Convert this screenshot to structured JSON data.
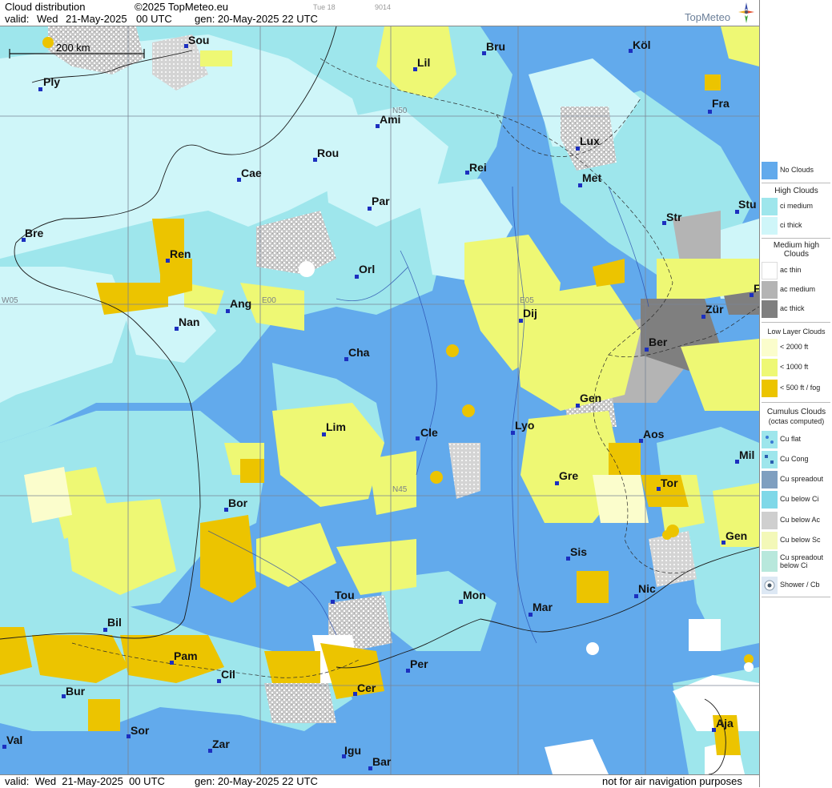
{
  "header": {
    "title": "Cloud distribution",
    "copyright": "©2025 TopMeteo.eu",
    "valid_label": "valid:",
    "valid_day": "Wed",
    "valid_date": "21-May-2025",
    "valid_time": "00 UTC",
    "generated": "gen: 20-May-2025 22 UTC",
    "small_1": "Tue 18",
    "small_2": "9014",
    "brand": "TopMeteo"
  },
  "footer": {
    "valid_text": "valid:  Wed  21-May-2025  00 UTC",
    "generated_text": "gen: 20-May-2025 22 UTC",
    "disclaimer": "not for air navigation purposes"
  },
  "map": {
    "scale_label": "200 km",
    "grid_labels": [
      "N50",
      "N45",
      "W05",
      "E00",
      "E05"
    ],
    "cities": [
      "Ply",
      "Sou",
      "Lil",
      "Bru",
      "Köl",
      "Ami",
      "Fra",
      "Lux",
      "Rou",
      "Cae",
      "Rei",
      "Met",
      "Par",
      "Bre",
      "Stu",
      "Str",
      "Ren",
      "Orl",
      "Ang",
      "Dij",
      "Zür",
      "Nan",
      "Cha",
      "Ber",
      "Gen",
      "Lim",
      "Cle",
      "Lyo",
      "Aos",
      "Mil",
      "Gre",
      "Tor",
      "Bor",
      "Gen",
      "Sis",
      "Tou",
      "Mon",
      "Nic",
      "Mar",
      "Bil",
      "Pam",
      "Per",
      "Cil",
      "Cer",
      "Bur",
      "Sor",
      "Val",
      "Zar",
      "Igu",
      "Aja",
      "Bar",
      "F"
    ]
  },
  "legend": {
    "no_clouds": "No Clouds",
    "high_title": "High Clouds",
    "high_items": [
      "ci medium",
      "ci thick"
    ],
    "medium_title": "Medium high Clouds",
    "medium_items": [
      "ac thin",
      "ac medium",
      "ac thick"
    ],
    "low_title": "Low Layer Clouds",
    "low_items": [
      "< 2000 ft",
      "< 1000 ft",
      "< 500 ft / fog"
    ],
    "cumulus_title": "Cumulus Clouds",
    "cumulus_subtitle": "(octas computed)",
    "cumulus_items": [
      "Cu flat",
      "Cu Cong",
      "Cu spreadout",
      "Cu below Ci",
      "Cu below Ac",
      "Cu below Sc",
      "Cu spreadout below Ci",
      "Shower / Cb"
    ]
  },
  "colors": {
    "no_clouds": "#62aaec",
    "ci_medium": "#9ee6ec",
    "ci_thick": "#cff6f9",
    "ac_thin": "#ffffff",
    "ac_medium": "#b4b4b4",
    "ac_thick": "#7f7f7f",
    "low_2000": "#fbfdcc",
    "low_1000": "#eef874",
    "low_500": "#ecc400",
    "city_dot": "#1c2fbf"
  }
}
